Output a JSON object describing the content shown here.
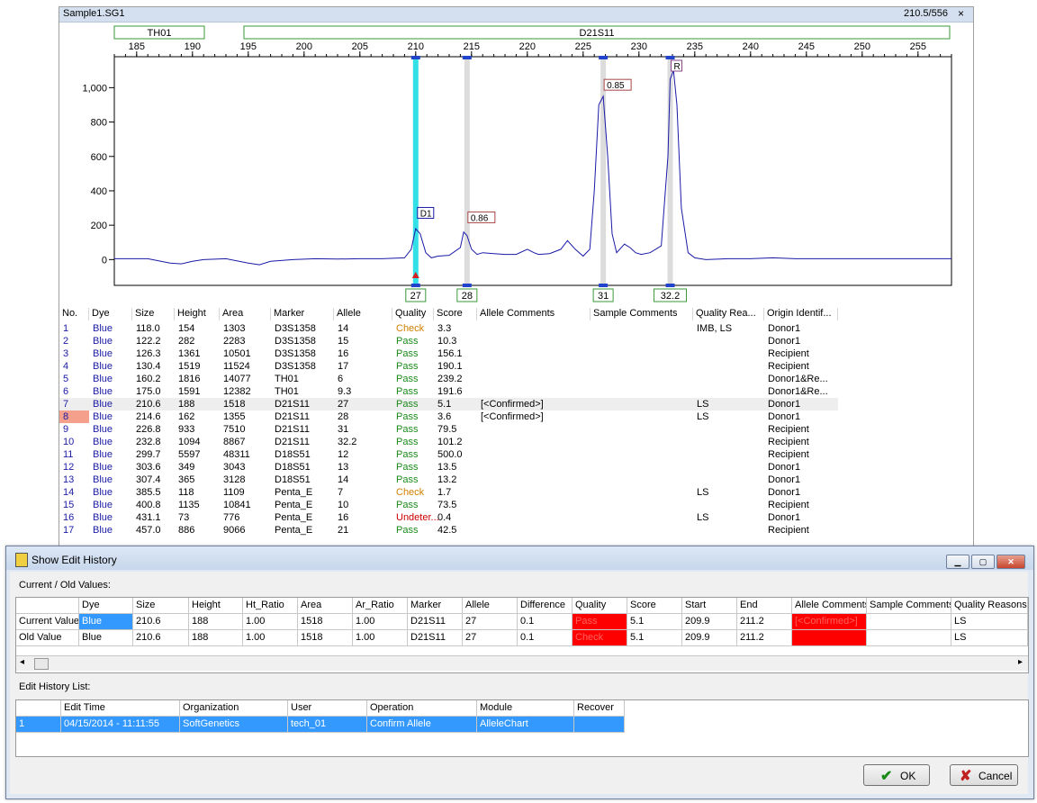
{
  "top_window": {
    "title": "Sample1.SG1",
    "position_readout": "210.5/556",
    "close_glyph": "×"
  },
  "electropherogram": {
    "markers": [
      "TH01",
      "D21S11"
    ],
    "x_ticks": [
      "185",
      "190",
      "195",
      "200",
      "205",
      "210",
      "215",
      "220",
      "225",
      "230",
      "235",
      "240",
      "245",
      "250",
      "255"
    ],
    "y_ticks": [
      "1,000",
      "800",
      "600",
      "400",
      "200",
      "0"
    ],
    "peak_labels": [
      "D1",
      "0.86",
      "0.85",
      "R"
    ],
    "allele_boxes": [
      "27",
      "28",
      "31",
      "32.2"
    ],
    "trace_color": "#1a1aa6",
    "highlight_color": "#33e0e8"
  },
  "chart_data": {
    "type": "line",
    "title": "",
    "xlabel": "",
    "ylabel": "",
    "xlim": [
      183,
      258
    ],
    "ylim": [
      -150,
      1180
    ],
    "series": [
      {
        "x": [
          183,
          186,
          188,
          189,
          190,
          191,
          193,
          195,
          196,
          197,
          199,
          201,
          203,
          205,
          207,
          209,
          209.6,
          210.0,
          210.4,
          210.9,
          211.4,
          212,
          213,
          214,
          214.3,
          214.6,
          215,
          215.5,
          216,
          217,
          218,
          219,
          220,
          220.6,
          221,
          222,
          223,
          223.6,
          224.3,
          225,
          225.6,
          226,
          226.4,
          226.8,
          227.2,
          227.6,
          228,
          228.7,
          229.2,
          229.7,
          230.2,
          231,
          232,
          232.6,
          232.8,
          233.1,
          233.4,
          233.8,
          234.4,
          235,
          236,
          238,
          240,
          242,
          244,
          246,
          248,
          250,
          252,
          254,
          256,
          258
        ],
        "y": [
          5,
          5,
          -20,
          -25,
          -10,
          0,
          5,
          -20,
          -30,
          -10,
          0,
          5,
          3,
          5,
          5,
          10,
          60,
          180,
          150,
          40,
          10,
          20,
          25,
          70,
          160,
          140,
          60,
          30,
          40,
          35,
          30,
          30,
          60,
          40,
          30,
          35,
          60,
          110,
          60,
          20,
          60,
          400,
          900,
          950,
          600,
          150,
          40,
          90,
          70,
          40,
          30,
          40,
          80,
          600,
          1050,
          1100,
          900,
          300,
          40,
          10,
          0,
          5,
          5,
          10,
          5,
          5,
          5,
          5,
          5,
          5,
          5,
          5
        ]
      }
    ],
    "peaks": [
      {
        "size": 210.0,
        "height": 188,
        "allele": "27",
        "label": "D1"
      },
      {
        "size": 214.6,
        "height": 162,
        "allele": "28",
        "label": "0.86"
      },
      {
        "size": 226.8,
        "height": 933,
        "allele": "31",
        "label": "0.85"
      },
      {
        "size": 232.8,
        "height": 1094,
        "allele": "32.2",
        "label": "R"
      }
    ],
    "marker_ranges": [
      {
        "name": "TH01",
        "from": 185,
        "to": 195
      },
      {
        "name": "D21S11",
        "from": 195,
        "to": 257
      }
    ],
    "grid": false
  },
  "peak_grid": {
    "columns": [
      "No.",
      "Dye",
      "Size",
      "Height",
      "Area",
      "Marker",
      "Allele",
      "Quality",
      "Score",
      "Allele Comments",
      "Sample Comments",
      "Quality Rea...",
      "Origin Identif..."
    ],
    "rows": [
      [
        "1",
        "Blue",
        "118.0",
        "154",
        "1303",
        "D3S1358",
        "14",
        "Check",
        "3.3",
        "",
        "",
        "IMB, LS",
        "Donor1"
      ],
      [
        "2",
        "Blue",
        "122.2",
        "282",
        "2283",
        "D3S1358",
        "15",
        "Pass",
        "10.3",
        "",
        "",
        "",
        "Donor1"
      ],
      [
        "3",
        "Blue",
        "126.3",
        "1361",
        "10501",
        "D3S1358",
        "16",
        "Pass",
        "156.1",
        "",
        "",
        "",
        "Recipient"
      ],
      [
        "4",
        "Blue",
        "130.4",
        "1519",
        "11524",
        "D3S1358",
        "17",
        "Pass",
        "190.1",
        "",
        "",
        "",
        "Recipient"
      ],
      [
        "5",
        "Blue",
        "160.2",
        "1816",
        "14077",
        "TH01",
        "6",
        "Pass",
        "239.2",
        "",
        "",
        "",
        "Donor1&Re..."
      ],
      [
        "6",
        "Blue",
        "175.0",
        "1591",
        "12382",
        "TH01",
        "9.3",
        "Pass",
        "191.6",
        "",
        "",
        "",
        "Donor1&Re..."
      ],
      [
        "7",
        "Blue",
        "210.6",
        "188",
        "1518",
        "D21S11",
        "27",
        "Pass",
        "5.1",
        "[<Confirmed>]",
        "",
        "LS",
        "Donor1"
      ],
      [
        "8",
        "Blue",
        "214.6",
        "162",
        "1355",
        "D21S11",
        "28",
        "Pass",
        "3.6",
        "[<Confirmed>]",
        "",
        "LS",
        "Donor1"
      ],
      [
        "9",
        "Blue",
        "226.8",
        "933",
        "7510",
        "D21S11",
        "31",
        "Pass",
        "79.5",
        "",
        "",
        "",
        "Recipient"
      ],
      [
        "10",
        "Blue",
        "232.8",
        "1094",
        "8867",
        "D21S11",
        "32.2",
        "Pass",
        "101.2",
        "",
        "",
        "",
        "Recipient"
      ],
      [
        "11",
        "Blue",
        "299.7",
        "5597",
        "48311",
        "D18S51",
        "12",
        "Pass",
        "500.0",
        "",
        "",
        "",
        "Recipient"
      ],
      [
        "12",
        "Blue",
        "303.6",
        "349",
        "3043",
        "D18S51",
        "13",
        "Pass",
        "13.5",
        "",
        "",
        "",
        "Donor1"
      ],
      [
        "13",
        "Blue",
        "307.4",
        "365",
        "3128",
        "D18S51",
        "14",
        "Pass",
        "13.2",
        "",
        "",
        "",
        "Donor1"
      ],
      [
        "14",
        "Blue",
        "385.5",
        "118",
        "1109",
        "Penta_E",
        "7",
        "Check",
        "1.7",
        "",
        "",
        "LS",
        "Donor1"
      ],
      [
        "15",
        "Blue",
        "400.8",
        "1135",
        "10841",
        "Penta_E",
        "10",
        "Pass",
        "73.5",
        "",
        "",
        "",
        "Recipient"
      ],
      [
        "16",
        "Blue",
        "431.1",
        "73",
        "776",
        "Penta_E",
        "16",
        "Undeter...",
        "0.4",
        "",
        "",
        "LS",
        "Donor1"
      ],
      [
        "17",
        "Blue",
        "457.0",
        "886",
        "9066",
        "Penta_E",
        "21",
        "Pass",
        "42.5",
        "",
        "",
        "",
        "Recipient"
      ]
    ]
  },
  "dialog": {
    "title": "Show Edit History",
    "current_old_label": "Current / Old Values:",
    "values_columns": [
      "",
      "Dye",
      "Size",
      "Height",
      "Ht_Ratio",
      "Area",
      "Ar_Ratio",
      "Marker",
      "Allele",
      "Difference",
      "Quality",
      "Score",
      "Start",
      "End",
      "Allele Comments",
      "Sample Comments",
      "Quality Reasons"
    ],
    "values_rows": [
      [
        "Current Value",
        "Blue",
        "210.6",
        "188",
        "1.00",
        "1518",
        "1.00",
        "D21S11",
        "27",
        "0.1",
        "Pass",
        "5.1",
        "209.9",
        "211.2",
        "[<Confirmed>]",
        "",
        "LS"
      ],
      [
        "Old Value",
        "Blue",
        "210.6",
        "188",
        "1.00",
        "1518",
        "1.00",
        "D21S11",
        "27",
        "0.1",
        "Check",
        "5.1",
        "209.9",
        "211.2",
        "",
        "",
        "LS"
      ]
    ],
    "history_label": "Edit History List:",
    "history_columns": [
      "",
      "Edit Time",
      "Organization",
      "User",
      "Operation",
      "Module",
      "Recover"
    ],
    "history_rows": [
      [
        "1",
        "04/15/2014 - 11:11:55",
        "SoftGenetics",
        "tech_01",
        "Confirm Allele",
        "AlleleChart",
        ""
      ]
    ],
    "ok_label": "OK",
    "cancel_label": "Cancel",
    "scroll_left": "◂",
    "scroll_right": "▸"
  }
}
